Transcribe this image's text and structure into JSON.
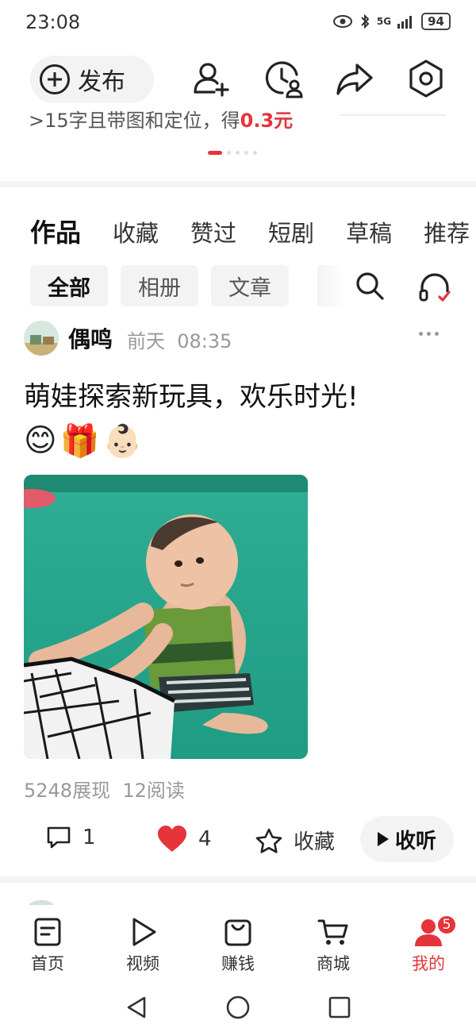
{
  "status_bar": {
    "time": "23:08",
    "network": "5G",
    "battery": "94"
  },
  "top_actions": {
    "publish_label": "发布"
  },
  "promo": {
    "text_prefix": ">15字且带图和定位，得",
    "reward": "0.3元"
  },
  "carousel": {
    "page_count": 5,
    "active_index": 0
  },
  "tabs": [
    {
      "label": "作品",
      "active": true
    },
    {
      "label": "收藏",
      "active": false
    },
    {
      "label": "赞过",
      "active": false
    },
    {
      "label": "短剧",
      "active": false
    },
    {
      "label": "草稿",
      "active": false
    },
    {
      "label": "推荐",
      "active": false
    }
  ],
  "filters": [
    {
      "label": "全部",
      "active": true
    },
    {
      "label": "相册",
      "active": false
    },
    {
      "label": "文章",
      "active": false
    }
  ],
  "post": {
    "author": "偶鸣",
    "date": "前天",
    "time": "08:35",
    "title": "萌娃探索新玩具，欢乐时光!",
    "emojis": [
      "😊",
      "🎁",
      "👶🏻"
    ],
    "impressions": "5248展现",
    "reads": "12阅读",
    "comments": "1",
    "likes": "4",
    "favorite_label": "收藏",
    "listen_label": "收听"
  },
  "bottom_nav": [
    {
      "label": "首页",
      "icon": "home-doc-icon",
      "active": false
    },
    {
      "label": "视频",
      "icon": "video-play-icon",
      "active": false
    },
    {
      "label": "赚钱",
      "icon": "money-bag-icon",
      "active": false
    },
    {
      "label": "商城",
      "icon": "cart-icon",
      "active": false
    },
    {
      "label": "我的",
      "icon": "profile-icon",
      "active": true,
      "badge": "5"
    }
  ],
  "colors": {
    "accent": "#e5343a",
    "chip_bg": "#f3f3f3",
    "text": "#222222",
    "muted": "#999999"
  }
}
